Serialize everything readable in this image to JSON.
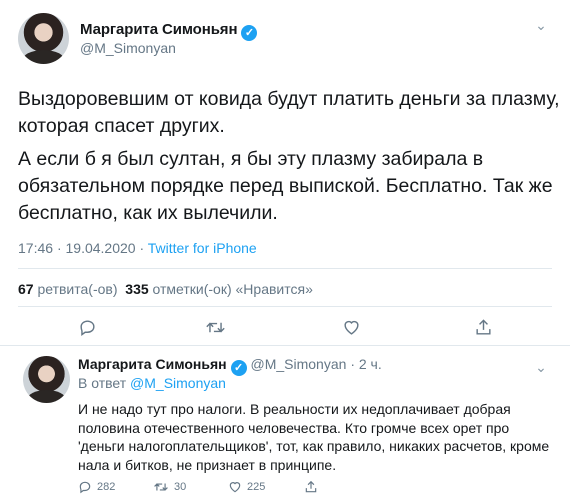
{
  "main_tweet": {
    "author_name": "Маргарита Симоньян",
    "verified_mark": "✓",
    "handle": "@M_Simonyan",
    "chevron": "⌄",
    "paragraph_1_line_1": "Выздоровевшим от ковида будут платить деньги за плазму,",
    "paragraph_1_line_2": "которая спасет других.",
    "paragraph_2_line_1": "А если б я был султан, я бы эту плазму забирала в",
    "paragraph_2_line_2": "обязательном порядке перед выпиской. Бесплатно. Так же",
    "paragraph_2_line_3": "бесплатно, как их вылечили.",
    "time": "17:46",
    "date": "19.04.2020",
    "separator": "·",
    "source": "Twitter for iPhone",
    "retweets_count": "67",
    "retweets_label": "ретвита(-ов)",
    "likes_count": "335",
    "likes_label": "отметки(-ок) «Нравится»"
  },
  "reply_tweet": {
    "author_name": "Маргарита Симоньян",
    "verified_mark": "✓",
    "handle": "@M_Simonyan",
    "time_ago": "· 2 ч.",
    "reply_to_label": "В ответ",
    "reply_to_mention": "@M_Simonyan",
    "text_line_1": "И не надо тут про налоги. В реальности их недоплачивает добрая",
    "text_line_2": "половина отечественного человечества. Кто громче всех орет про",
    "text_line_3": "'деньги налогоплательщиков', тот, как правило, никаких расчетов, кроме",
    "text_line_4": "нала и битков, не признает в принципе.",
    "reply_count": "282",
    "retweet_count": "30",
    "like_count": "225"
  },
  "icons": [
    "reply-icon",
    "retweet-icon",
    "like-icon",
    "share-icon",
    "chevron-down-icon",
    "verified-icon"
  ],
  "colors": {
    "link": "#1da1f2",
    "muted": "#657786",
    "text": "#14171a",
    "divider": "#e1e8ed"
  }
}
